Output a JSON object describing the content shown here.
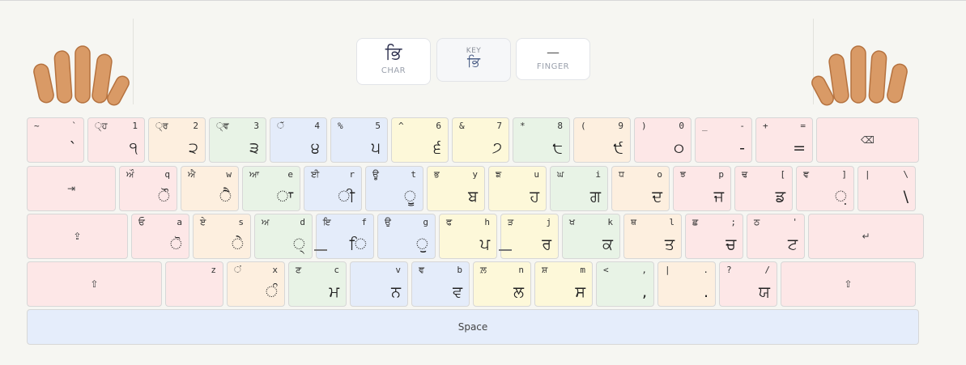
{
  "info": {
    "char_value": "ਭਿ",
    "char_caption": "CHAR",
    "key_caption": "KEY",
    "key_value": "ਭਿ",
    "finger_value": "—",
    "finger_caption": "FINGER"
  },
  "rows": [
    [
      {
        "tl": "~",
        "tr": "`",
        "main": "`",
        "color": "pink"
      },
      {
        "tl": "◌੍ਹ",
        "tr": "1",
        "main": "੧",
        "color": "pink"
      },
      {
        "tl": "◌੍ਰ",
        "tr": "2",
        "main": "੨",
        "color": "orange"
      },
      {
        "tl": "◌੍ਵ",
        "tr": "3",
        "main": "੩",
        "color": "green"
      },
      {
        "tl": "◌ੱ",
        "tr": "4",
        "main": "੪",
        "color": "blue"
      },
      {
        "tl": "%",
        "tr": "5",
        "main": "੫",
        "color": "blue"
      },
      {
        "tl": "^",
        "tr": "6",
        "main": "੬",
        "color": "yellow"
      },
      {
        "tl": "&",
        "tr": "7",
        "main": "੭",
        "color": "yellow"
      },
      {
        "tl": "*",
        "tr": "8",
        "main": "੮",
        "color": "green"
      },
      {
        "tl": "(",
        "tr": "9",
        "main": "੯",
        "color": "orange"
      },
      {
        "tl": ")",
        "tr": "0",
        "main": "੦",
        "color": "pink"
      },
      {
        "tl": "_",
        "tr": "-",
        "main": "-",
        "color": "pink"
      },
      {
        "tl": "+",
        "tr": "=",
        "main": "=",
        "color": "pink"
      },
      {
        "center": "⌫",
        "color": "pink"
      }
    ],
    [
      {
        "center": "⇥",
        "color": "pink"
      },
      {
        "tl": "ਔ",
        "tr": "q",
        "main": "ੌ",
        "color": "pink"
      },
      {
        "tl": "ਐ",
        "tr": "w",
        "main": "ੈ",
        "color": "orange"
      },
      {
        "tl": "ਆ",
        "tr": "e",
        "main": "ਾ",
        "color": "green"
      },
      {
        "tl": "ਈ",
        "tr": "r",
        "main": "ੀ",
        "color": "blue"
      },
      {
        "tl": "ਊ",
        "tr": "t",
        "main": "ੂ",
        "color": "blue"
      },
      {
        "tl": "ਭ",
        "tr": "y",
        "main": "ਬ",
        "color": "yellow"
      },
      {
        "tl": "ਙ",
        "tr": "u",
        "main": "ਹ",
        "color": "yellow"
      },
      {
        "tl": "ਘ",
        "tr": "i",
        "main": "ਗ",
        "color": "green"
      },
      {
        "tl": "ਧ",
        "tr": "o",
        "main": "ਦ",
        "color": "orange"
      },
      {
        "tl": "ਝ",
        "tr": "p",
        "main": "ਜ",
        "color": "pink"
      },
      {
        "tl": "ਢ",
        "tr": "[",
        "main": "ਡ",
        "color": "pink"
      },
      {
        "tl": "ਞ",
        "tr": "]",
        "main": "਼",
        "color": "pink"
      },
      {
        "tl": "|",
        "tr": "\\",
        "main": "\\",
        "color": "pink"
      }
    ],
    [
      {
        "center": "⇪",
        "color": "pink"
      },
      {
        "tl": "ਓ",
        "tr": "a",
        "main": "ੋ",
        "color": "pink"
      },
      {
        "tl": "ਏ",
        "tr": "s",
        "main": "ੇ",
        "color": "orange"
      },
      {
        "tl": "ਅ",
        "tr": "d",
        "main": "੍",
        "color": "green"
      },
      {
        "tl": "ਇ",
        "tr": "f",
        "main": "ਿ",
        "color": "blue",
        "bump": true
      },
      {
        "tl": "ਉ",
        "tr": "g",
        "main": "ੁ",
        "color": "blue"
      },
      {
        "tl": "ਫ",
        "tr": "h",
        "main": "ਪ",
        "color": "yellow"
      },
      {
        "tl": "ੜ",
        "tr": "j",
        "main": "ਰ",
        "color": "yellow",
        "bump": true
      },
      {
        "tl": "ਖ",
        "tr": "k",
        "main": "ਕ",
        "color": "green"
      },
      {
        "tl": "ਥ",
        "tr": "l",
        "main": "ਤ",
        "color": "orange"
      },
      {
        "tl": "ਛ",
        "tr": ";",
        "main": "ਚ",
        "color": "pink"
      },
      {
        "tl": "ਠ",
        "tr": "'",
        "main": "ਟ",
        "color": "pink"
      },
      {
        "center": "↵",
        "color": "pink"
      }
    ],
    [
      {
        "center": "⇧",
        "color": "pink"
      },
      {
        "tl": "",
        "tr": "z",
        "main": "",
        "color": "pink"
      },
      {
        "tl": "◌ਂ",
        "tr": "x",
        "main": "ੰ",
        "color": "orange"
      },
      {
        "tl": "ਣ",
        "tr": "c",
        "main": "ਮ",
        "color": "green"
      },
      {
        "tl": "",
        "tr": "v",
        "main": "ਨ",
        "color": "blue"
      },
      {
        "tl": "ਞ",
        "tr": "b",
        "main": "ਵ",
        "color": "blue"
      },
      {
        "tl": "ਲ਼",
        "tr": "n",
        "main": "ਲ",
        "color": "yellow"
      },
      {
        "tl": "ਸ਼",
        "tr": "m",
        "main": "ਸ",
        "color": "yellow"
      },
      {
        "tl": "<",
        "tr": ",",
        "main": ",",
        "color": "green"
      },
      {
        "tl": "|",
        "tr": ".",
        "main": ".",
        "color": "orange"
      },
      {
        "tl": "?",
        "tr": "/",
        "main": "ਯ",
        "color": "pink"
      },
      {
        "center": "⇧",
        "color": "pink"
      }
    ]
  ],
  "space": {
    "label": "Space"
  },
  "colors": {
    "pink": "#fde7e7",
    "orange": "#fdefdf",
    "green": "#e8f3e6",
    "blue": "#e4ecfa",
    "yellow": "#fdf8d9",
    "space": "#e5edfb",
    "hand": "#d99a66"
  }
}
